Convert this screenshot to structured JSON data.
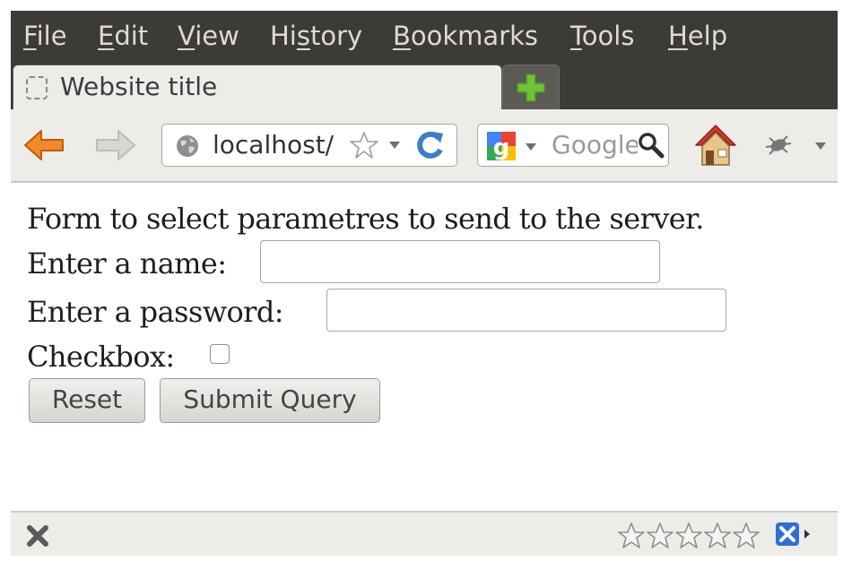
{
  "menu": {
    "items": [
      {
        "accel": "F",
        "rest": "ile"
      },
      {
        "accel": "E",
        "rest": "dit"
      },
      {
        "accel": "V",
        "rest": "iew"
      },
      {
        "pre": "Hi",
        "accel": "s",
        "rest": "tory"
      },
      {
        "accel": "B",
        "rest": "ookmarks"
      },
      {
        "accel": "T",
        "rest": "ools"
      },
      {
        "accel": "H",
        "rest": "elp"
      }
    ]
  },
  "tab": {
    "title": "Website title",
    "favicon": "blank-page-icon"
  },
  "newtab": {
    "icon": "plus-icon"
  },
  "navbar": {
    "back_icon": "back-arrow-icon",
    "forward_icon": "forward-arrow-icon",
    "url": "localhost/",
    "search_engine_icon": "google-icon",
    "search_placeholder": "Google",
    "home_icon": "home-icon",
    "addon_icon": "bug-icon"
  },
  "form": {
    "intro": "Form to select parametres to send to the server.",
    "name_label": "Enter a name:",
    "name_value": "",
    "password_label": "Enter a password:",
    "password_value": "",
    "checkbox_label": "Checkbox:",
    "checkbox_checked": false,
    "reset_label": "Reset",
    "submit_label": "Submit Query"
  },
  "statusbar": {
    "close_icon": "close-icon",
    "rating_stars_filled": 0,
    "rating_stars_total": 5
  },
  "colors": {
    "chrome_dark": "#3c3b37",
    "toolbar": "#edece9",
    "back_arrow": "#e8731c",
    "reload": "#3b7fc4",
    "home_roof": "#d23b2c",
    "plus": "#72c13b"
  }
}
